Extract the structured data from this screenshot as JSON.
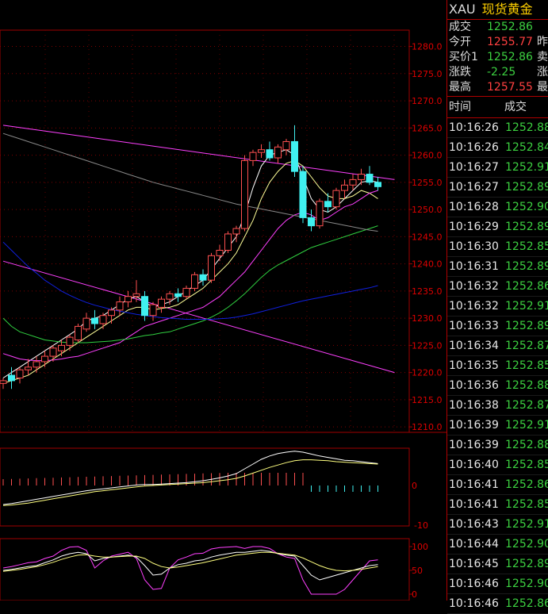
{
  "chart_data": {
    "type": "candlestick",
    "price_axis": {
      "ticks": [
        "1280.0",
        "1275.0",
        "1270.0",
        "1265.0",
        "1260.0",
        "1255.0",
        "1250.0",
        "1245.0",
        "1240.0",
        "1235.0",
        "1230.0",
        "1225.0",
        "1220.0",
        "1215.0",
        "1210.0"
      ],
      "ylim": [
        1209,
        1283
      ]
    },
    "macd_axis": {
      "ticks": [
        "0",
        "-10"
      ]
    },
    "kdj_axis": {
      "ticks": [
        "100",
        "50",
        "0"
      ]
    },
    "candles": [
      {
        "o": 1218,
        "h": 1219,
        "l": 1217,
        "c": 1218.5
      },
      {
        "o": 1219.5,
        "h": 1221,
        "l": 1217,
        "c": 1218.5
      },
      {
        "o": 1219,
        "h": 1221,
        "l": 1218,
        "c": 1220.5
      },
      {
        "o": 1220.5,
        "h": 1222.5,
        "l": 1219.5,
        "c": 1221
      },
      {
        "o": 1221,
        "h": 1223,
        "l": 1220,
        "c": 1222
      },
      {
        "o": 1222,
        "h": 1224,
        "l": 1221,
        "c": 1223
      },
      {
        "o": 1223,
        "h": 1225,
        "l": 1222,
        "c": 1224.5
      },
      {
        "o": 1224,
        "h": 1226,
        "l": 1223,
        "c": 1225
      },
      {
        "o": 1225,
        "h": 1227,
        "l": 1224,
        "c": 1226.5
      },
      {
        "o": 1226,
        "h": 1229,
        "l": 1225.5,
        "c": 1228.5
      },
      {
        "o": 1228,
        "h": 1231,
        "l": 1227.5,
        "c": 1230
      },
      {
        "o": 1230,
        "h": 1231.5,
        "l": 1228,
        "c": 1229
      },
      {
        "o": 1229,
        "h": 1231,
        "l": 1228,
        "c": 1230.5
      },
      {
        "o": 1230.5,
        "h": 1232,
        "l": 1229,
        "c": 1231.5
      },
      {
        "o": 1231.5,
        "h": 1234,
        "l": 1230.5,
        "c": 1233
      },
      {
        "o": 1233,
        "h": 1235,
        "l": 1232,
        "c": 1234
      },
      {
        "o": 1234,
        "h": 1237,
        "l": 1233,
        "c": 1234.5
      },
      {
        "o": 1234,
        "h": 1235,
        "l": 1229.5,
        "c": 1230.5
      },
      {
        "o": 1230.5,
        "h": 1233,
        "l": 1229.5,
        "c": 1232.5
      },
      {
        "o": 1232,
        "h": 1234,
        "l": 1231,
        "c": 1233.5
      },
      {
        "o": 1233.5,
        "h": 1235,
        "l": 1232.5,
        "c": 1234.5
      },
      {
        "o": 1234.5,
        "h": 1235.5,
        "l": 1233,
        "c": 1234
      },
      {
        "o": 1234,
        "h": 1236,
        "l": 1233.5,
        "c": 1235.5
      },
      {
        "o": 1235.5,
        "h": 1238.5,
        "l": 1235,
        "c": 1238
      },
      {
        "o": 1238,
        "h": 1239,
        "l": 1236,
        "c": 1237
      },
      {
        "o": 1237,
        "h": 1242,
        "l": 1236.5,
        "c": 1241.5
      },
      {
        "o": 1241.5,
        "h": 1243.5,
        "l": 1240.5,
        "c": 1242.5
      },
      {
        "o": 1242.5,
        "h": 1246,
        "l": 1242,
        "c": 1245.5
      },
      {
        "o": 1245.5,
        "h": 1247,
        "l": 1244,
        "c": 1246.5
      },
      {
        "o": 1246.5,
        "h": 1260,
        "l": 1246,
        "c": 1259
      },
      {
        "o": 1259,
        "h": 1261,
        "l": 1258,
        "c": 1260.5
      },
      {
        "o": 1260.5,
        "h": 1262,
        "l": 1259.5,
        "c": 1261
      },
      {
        "o": 1261,
        "h": 1262.5,
        "l": 1259,
        "c": 1259.5
      },
      {
        "o": 1259.5,
        "h": 1262,
        "l": 1258.5,
        "c": 1261.5
      },
      {
        "o": 1261,
        "h": 1263,
        "l": 1260,
        "c": 1262.5
      },
      {
        "o": 1262.5,
        "h": 1265.5,
        "l": 1256,
        "c": 1257
      },
      {
        "o": 1257,
        "h": 1258,
        "l": 1247.5,
        "c": 1248.5
      },
      {
        "o": 1248.5,
        "h": 1250,
        "l": 1246,
        "c": 1247
      },
      {
        "o": 1247,
        "h": 1252,
        "l": 1246.5,
        "c": 1251.5
      },
      {
        "o": 1251.5,
        "h": 1253,
        "l": 1249.5,
        "c": 1250.5
      },
      {
        "o": 1250.5,
        "h": 1254,
        "l": 1250,
        "c": 1253.5
      },
      {
        "o": 1253.5,
        "h": 1255.5,
        "l": 1252,
        "c": 1254.5
      },
      {
        "o": 1254.5,
        "h": 1256.5,
        "l": 1253.5,
        "c": 1255.5
      },
      {
        "o": 1255.5,
        "h": 1257.5,
        "l": 1254.5,
        "c": 1256.5
      },
      {
        "o": 1256.5,
        "h": 1258,
        "l": 1254.5,
        "c": 1255
      },
      {
        "o": 1255,
        "h": 1256,
        "l": 1253.5,
        "c": 1254.2
      }
    ],
    "ma_lines": [
      {
        "color": "#ffffff",
        "values": [
          1219,
          1220,
          1221,
          1222,
          1223,
          1224,
          1225,
          1226,
          1227,
          1228,
          1229.5,
          1230,
          1230.5,
          1231.5,
          1232.5,
          1233.5,
          1234,
          1233,
          1232,
          1232.5,
          1233,
          1234,
          1235,
          1236,
          1237,
          1239,
          1241,
          1243,
          1245,
          1249,
          1254,
          1258,
          1260,
          1260.5,
          1261,
          1260,
          1256,
          1252,
          1250,
          1249.5,
          1250.5,
          1252,
          1253.5,
          1255,
          1255.3,
          1255
        ]
      },
      {
        "color": "#ffff99",
        "values": [
          1218,
          1218.5,
          1219,
          1219.5,
          1220.5,
          1221.5,
          1222.5,
          1223.5,
          1224.5,
          1225.5,
          1226.5,
          1227.5,
          1228.5,
          1229.5,
          1230.5,
          1231.5,
          1232,
          1232,
          1231.5,
          1231.8,
          1232,
          1232.5,
          1233.5,
          1234.5,
          1235.5,
          1237,
          1238.5,
          1240,
          1242,
          1245,
          1248,
          1252,
          1255,
          1257,
          1258.5,
          1259,
          1258,
          1256,
          1254,
          1252.5,
          1252,
          1252,
          1252.5,
          1253.5,
          1253,
          1252
        ]
      },
      {
        "color": "#ff40ff",
        "values": [
          1223.5,
          1223,
          1222.5,
          1222.3,
          1222.2,
          1222.2,
          1222.3,
          1222.5,
          1222.8,
          1223,
          1223.5,
          1224,
          1224.5,
          1225,
          1225.5,
          1226.5,
          1227.5,
          1228.5,
          1229,
          1229.5,
          1230,
          1230.5,
          1231,
          1231.5,
          1232,
          1233,
          1234,
          1235.5,
          1237,
          1238.5,
          1240.5,
          1242.5,
          1244.5,
          1246.5,
          1248,
          1249,
          1249.5,
          1249,
          1248,
          1248.5,
          1249.5,
          1250.5,
          1251,
          1252,
          1253,
          1253.5
        ]
      },
      {
        "color": "#30d040",
        "values": [
          1230,
          1228.5,
          1227.5,
          1227,
          1226.5,
          1226,
          1225.8,
          1225.6,
          1225.5,
          1225.5,
          1225.5,
          1225.6,
          1225.7,
          1225.8,
          1226,
          1226.2,
          1226.5,
          1226.8,
          1227,
          1227.3,
          1227.5,
          1228,
          1228.5,
          1229,
          1229.5,
          1230.2,
          1231,
          1232,
          1233.2,
          1234.5,
          1236,
          1237.5,
          1238.8,
          1239.8,
          1240.6,
          1241.4,
          1242.2,
          1243,
          1243.5,
          1244,
          1244.5,
          1245,
          1245.5,
          1246,
          1246.5,
          1247
        ]
      },
      {
        "color": "#1020e0",
        "values": [
          1244,
          1242.5,
          1241,
          1239.5,
          1238.3,
          1237,
          1236,
          1235,
          1234.2,
          1233.5,
          1232.9,
          1232.4,
          1232,
          1231.6,
          1231.3,
          1231,
          1230.7,
          1230.5,
          1230.3,
          1230.1,
          1230,
          1229.9,
          1229.8,
          1229.8,
          1229.8,
          1229.8,
          1229.9,
          1230,
          1230.2,
          1230.5,
          1230.8,
          1231.2,
          1231.6,
          1232,
          1232.4,
          1232.8,
          1233.2,
          1233.5,
          1233.8,
          1234.1,
          1234.4,
          1234.7,
          1235,
          1235.3,
          1235.6,
          1236
        ]
      },
      {
        "color": "#888888",
        "values": [
          1264,
          1263.5,
          1263,
          1262.5,
          1262,
          1261.5,
          1261,
          1260.5,
          1260,
          1259.5,
          1259,
          1258.5,
          1258,
          1257.5,
          1257,
          1256.5,
          1256,
          1255.5,
          1255,
          1254.6,
          1254.2,
          1253.8,
          1253.4,
          1253,
          1252.6,
          1252.2,
          1251.8,
          1251.4,
          1251,
          1250.7,
          1250.4,
          1250.1,
          1249.8,
          1249.5,
          1249.2,
          1248.9,
          1248.6,
          1248.3,
          1248,
          1247.7,
          1247.4,
          1247.1,
          1246.8,
          1246.5,
          1246.2,
          1246
        ]
      }
    ],
    "trend_lines": [
      {
        "color": "#ff40ff",
        "from": [
          0,
          1265.5
        ],
        "to": [
          47,
          1255.5
        ]
      },
      {
        "color": "#ff40ff",
        "from": [
          0,
          1240.5
        ],
        "to": [
          47,
          1220
        ]
      }
    ],
    "macd": {
      "dif": [
        -4,
        -3.8,
        -3.5,
        -3.2,
        -2.9,
        -2.6,
        -2.3,
        -2,
        -1.7,
        -1.4,
        -1.1,
        -0.9,
        -0.7,
        -0.5,
        -0.3,
        -0.1,
        0.1,
        0.2,
        0.2,
        0.3,
        0.4,
        0.5,
        0.6,
        0.8,
        1,
        1.3,
        1.6,
        2,
        2.5,
        3.5,
        4.5,
        5.5,
        6.2,
        6.7,
        7,
        7.2,
        7,
        6.6,
        6.2,
        5.9,
        5.6,
        5.3,
        5.2,
        5,
        4.8,
        4.6
      ],
      "dea": [
        -4.2,
        -4.1,
        -3.9,
        -3.7,
        -3.4,
        -3.1,
        -2.8,
        -2.5,
        -2.2,
        -1.9,
        -1.6,
        -1.3,
        -1.1,
        -0.9,
        -0.7,
        -0.5,
        -0.3,
        -0.1,
        0,
        0.1,
        0.2,
        0.3,
        0.4,
        0.5,
        0.6,
        0.8,
        1,
        1.2,
        1.5,
        2,
        2.6,
        3.2,
        3.8,
        4.3,
        4.8,
        5.2,
        5.4,
        5.4,
        5.3,
        5.2,
        5,
        4.9,
        4.8,
        4.7,
        4.6,
        4.5
      ],
      "hist": [
        1,
        1,
        1,
        1,
        1,
        1,
        1,
        1,
        1,
        1,
        1,
        1,
        1,
        1,
        1,
        1,
        1,
        1,
        1,
        1,
        1,
        1,
        1,
        1,
        1,
        1,
        1,
        1,
        1,
        1,
        1,
        1,
        1,
        1,
        1,
        1,
        0.5,
        -0.5,
        -1,
        -1,
        -1,
        -1,
        -1,
        -1,
        -1,
        -1
      ]
    },
    "kdj": {
      "k": [
        50,
        52,
        55,
        58,
        60,
        66,
        72,
        80,
        85,
        88,
        85,
        70,
        75,
        78,
        80,
        82,
        78,
        60,
        40,
        42,
        55,
        62,
        65,
        70,
        72,
        78,
        82,
        85,
        88,
        88,
        90,
        92,
        90,
        85,
        82,
        80,
        60,
        40,
        30,
        35,
        40,
        45,
        50,
        55,
        60,
        62
      ],
      "d": [
        48,
        50,
        52,
        55,
        58,
        62,
        67,
        73,
        78,
        82,
        83,
        80,
        78,
        78,
        79,
        80,
        80,
        75,
        65,
        58,
        55,
        57,
        60,
        63,
        66,
        70,
        74,
        78,
        82,
        84,
        86,
        88,
        88,
        86,
        84,
        82,
        76,
        68,
        60,
        54,
        50,
        49,
        50,
        52,
        55,
        58
      ],
      "j": [
        55,
        58,
        62,
        66,
        68,
        75,
        80,
        92,
        99,
        100,
        92,
        55,
        70,
        80,
        84,
        88,
        75,
        30,
        10,
        12,
        55,
        72,
        78,
        85,
        86,
        95,
        98,
        99,
        100,
        96,
        100,
        100,
        96,
        85,
        78,
        75,
        30,
        0,
        0,
        0,
        0,
        10,
        30,
        50,
        70,
        72
      ]
    }
  },
  "panel": {
    "symbol": "XAU",
    "name": "现货黄金",
    "quote": [
      {
        "label": "成交",
        "value": "1252.86",
        "color": "green",
        "right": ""
      },
      {
        "label": "今开",
        "value": "1255.77",
        "color": "red",
        "right": "昨"
      },
      {
        "label": "买价1",
        "value": "1252.86",
        "color": "green",
        "right": "卖"
      },
      {
        "label": "涨跌",
        "value": "-2.25",
        "color": "green",
        "right": "涨"
      },
      {
        "label": "最高",
        "value": "1257.55",
        "color": "red",
        "right": "最"
      }
    ],
    "ticks_header": {
      "time": "时间",
      "price": "成交"
    },
    "ticks": [
      {
        "time": "10:16:26",
        "price": "1252.88"
      },
      {
        "time": "10:16:26",
        "price": "1252.84"
      },
      {
        "time": "10:16:27",
        "price": "1252.91"
      },
      {
        "time": "10:16:27",
        "price": "1252.89"
      },
      {
        "time": "10:16:28",
        "price": "1252.90"
      },
      {
        "time": "10:16:29",
        "price": "1252.89"
      },
      {
        "time": "10:16:30",
        "price": "1252.85"
      },
      {
        "time": "10:16:31",
        "price": "1252.89"
      },
      {
        "time": "10:16:32",
        "price": "1252.86"
      },
      {
        "time": "10:16:32",
        "price": "1252.91"
      },
      {
        "time": "10:16:33",
        "price": "1252.89"
      },
      {
        "time": "10:16:34",
        "price": "1252.87"
      },
      {
        "time": "10:16:35",
        "price": "1252.85"
      },
      {
        "time": "10:16:36",
        "price": "1252.88"
      },
      {
        "time": "10:16:38",
        "price": "1252.87"
      },
      {
        "time": "10:16:39",
        "price": "1252.91"
      },
      {
        "time": "10:16:39",
        "price": "1252.88"
      },
      {
        "time": "10:16:40",
        "price": "1252.85"
      },
      {
        "time": "10:16:41",
        "price": "1252.86"
      },
      {
        "time": "10:16:41",
        "price": "1252.85"
      },
      {
        "time": "10:16:43",
        "price": "1252.91"
      },
      {
        "time": "10:16:44",
        "price": "1252.90"
      },
      {
        "time": "10:16:45",
        "price": "1252.89"
      },
      {
        "time": "10:16:46",
        "price": "1252.90"
      },
      {
        "time": "10:16:46",
        "price": "1252.86"
      }
    ]
  }
}
